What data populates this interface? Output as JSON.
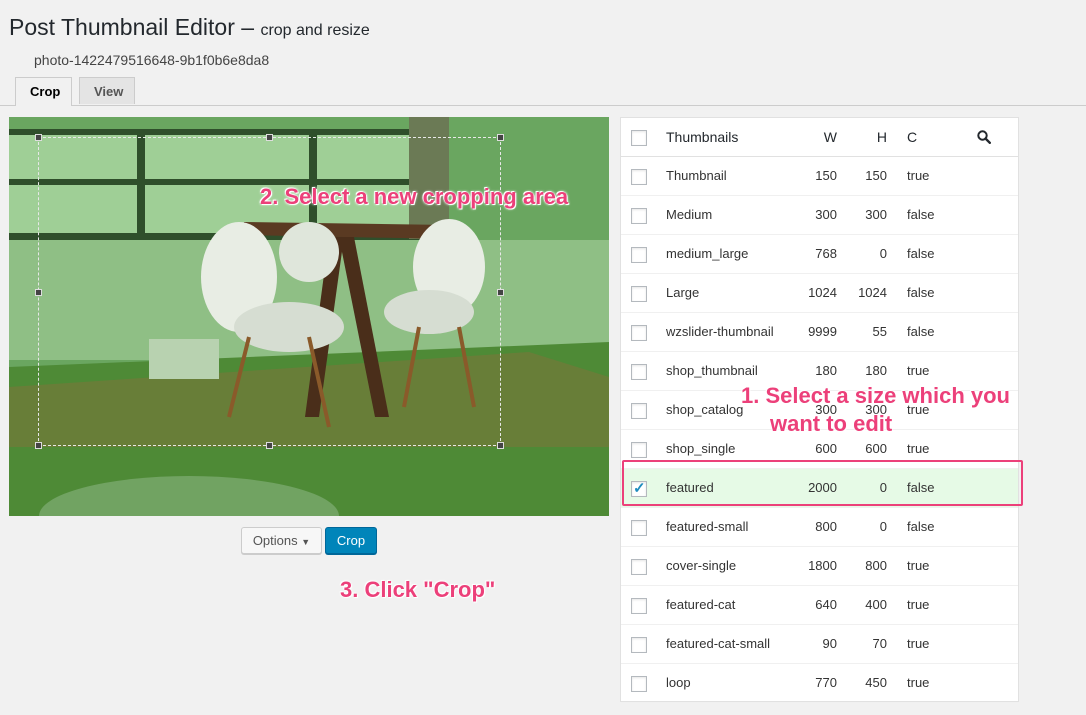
{
  "header": {
    "title": "Post Thumbnail Editor –",
    "subtitle": "crop and resize",
    "filename": "photo-1422479516648-9b1f0b6e8da8"
  },
  "tabs": [
    {
      "label": "Crop",
      "active": true
    },
    {
      "label": "View",
      "active": false
    }
  ],
  "buttons": {
    "options_label": "Options",
    "crop_label": "Crop"
  },
  "annotations": {
    "select_area": "2. Select a new cropping area",
    "select_size_line1": "1. Select a size which you",
    "select_size_line2": "want to edit",
    "click_crop": "3. Click \"Crop\""
  },
  "table": {
    "headers": {
      "name": "Thumbnails",
      "w": "W",
      "h": "H",
      "c": "C"
    },
    "rows": [
      {
        "name": "Thumbnail",
        "w": "150",
        "h": "150",
        "c": "true",
        "checked": false
      },
      {
        "name": "Medium",
        "w": "300",
        "h": "300",
        "c": "false",
        "checked": false
      },
      {
        "name": "medium_large",
        "w": "768",
        "h": "0",
        "c": "false",
        "checked": false
      },
      {
        "name": "Large",
        "w": "1024",
        "h": "1024",
        "c": "false",
        "checked": false
      },
      {
        "name": "wzslider-thumbnail",
        "w": "9999",
        "h": "55",
        "c": "false",
        "checked": false
      },
      {
        "name": "shop_thumbnail",
        "w": "180",
        "h": "180",
        "c": "true",
        "checked": false
      },
      {
        "name": "shop_catalog",
        "w": "300",
        "h": "300",
        "c": "true",
        "checked": false
      },
      {
        "name": "shop_single",
        "w": "600",
        "h": "600",
        "c": "true",
        "checked": false
      },
      {
        "name": "featured",
        "w": "2000",
        "h": "0",
        "c": "false",
        "checked": true
      },
      {
        "name": "featured-small",
        "w": "800",
        "h": "0",
        "c": "false",
        "checked": false
      },
      {
        "name": "cover-single",
        "w": "1800",
        "h": "800",
        "c": "true",
        "checked": false
      },
      {
        "name": "featured-cat",
        "w": "640",
        "h": "400",
        "c": "true",
        "checked": false
      },
      {
        "name": "featured-cat-small",
        "w": "90",
        "h": "70",
        "c": "true",
        "checked": false
      },
      {
        "name": "loop",
        "w": "770",
        "h": "450",
        "c": "true",
        "checked": false
      }
    ]
  },
  "colors": {
    "accent": "#0085ba",
    "annotation": "#ec407a",
    "selected_row": "#e6fae6",
    "overlay_green": "#4d8b43"
  },
  "icons": {
    "search": "search-icon",
    "dropdown": "caret-down-icon",
    "check": "checkmark-icon"
  }
}
